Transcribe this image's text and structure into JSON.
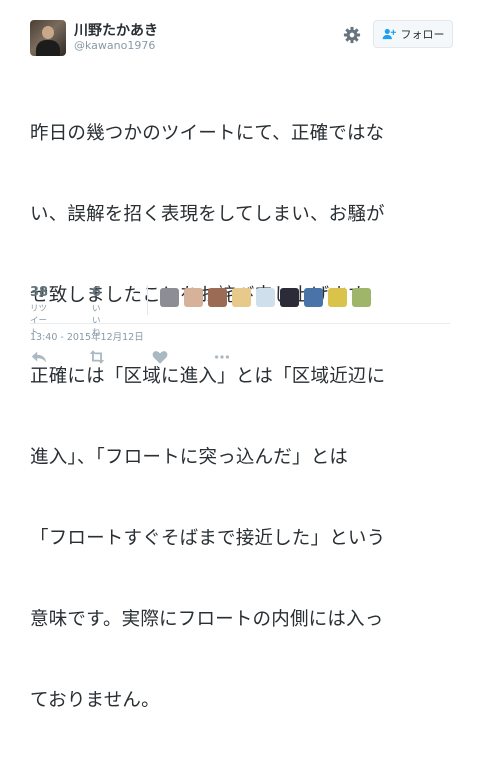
{
  "user": {
    "display_name": "川野たかあき",
    "handle": "@kawano1976"
  },
  "header": {
    "follow_label": "フォロー"
  },
  "tweet": {
    "lines": [
      "昨日の幾つかのツイートにて、正確ではな",
      "い、誤解を招く表現をしてしまい、お騒が",
      "せ致しましたことをお詫び申し上げます。",
      "正確には「区域に進入」とは「区域近辺に",
      "進入」、「フロートに突っ込んだ」とは",
      "「フロートすぐそばまで接近した」という",
      "意味です。実際にフロートの内側には入っ",
      "ておりません。"
    ]
  },
  "stats": {
    "retweets": {
      "count": "38",
      "label": "リツイート"
    },
    "likes": {
      "count": "6",
      "label": "いいね"
    }
  },
  "liker_avatars": [
    {
      "icon": "avatar-icon",
      "color": "#8d8d96"
    },
    {
      "icon": "avatar-icon",
      "color": "#d7b29a"
    },
    {
      "icon": "avatar-icon",
      "color": "#9c6b54"
    },
    {
      "icon": "avatar-icon",
      "color": "#e7c98b"
    },
    {
      "icon": "avatar-icon",
      "color": "#cfe0ec"
    },
    {
      "icon": "avatar-icon",
      "color": "#2c2c38"
    },
    {
      "icon": "avatar-icon",
      "color": "#4a74a8"
    },
    {
      "icon": "avatar-icon",
      "color": "#d9c34a"
    },
    {
      "icon": "avatar-icon",
      "color": "#9fb56a"
    }
  ],
  "timestamp": "13:40 - 2015年12月12日",
  "colors": {
    "text": "#292f33",
    "muted": "#8899a6",
    "border": "#e1e8ed",
    "icon": "#aab8c2",
    "follow_icon": "#1da1f2"
  }
}
